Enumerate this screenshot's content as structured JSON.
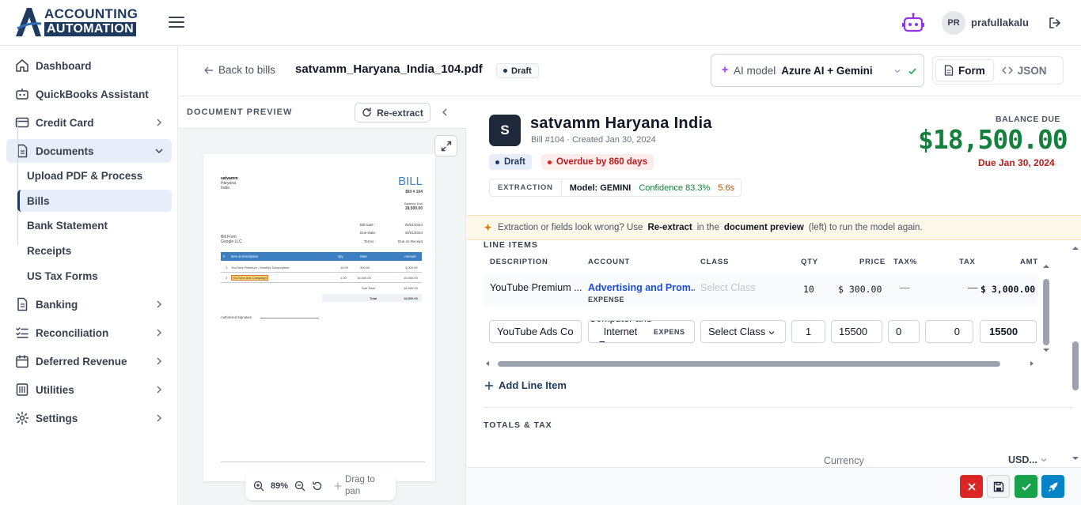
{
  "brand": {
    "line1": "ACCOUNTING",
    "line2": "AUTOMATION"
  },
  "user": {
    "initials": "PR",
    "name": "prafullakalu"
  },
  "sidebar": {
    "items": [
      {
        "label": "Dashboard"
      },
      {
        "label": "QuickBooks Assistant"
      },
      {
        "label": "Credit Card"
      },
      {
        "label": "Documents"
      },
      {
        "label": "Banking"
      },
      {
        "label": "Reconciliation"
      },
      {
        "label": "Deferred Revenue"
      },
      {
        "label": "Utilities"
      },
      {
        "label": "Settings"
      }
    ],
    "documents_sub": [
      {
        "label": "Upload PDF & Process"
      },
      {
        "label": "Bills"
      },
      {
        "label": "Bank Statement"
      },
      {
        "label": "Receipts"
      },
      {
        "label": "US Tax Forms"
      }
    ]
  },
  "header": {
    "back_label": "Back to bills",
    "filename": "satvamm_Haryana_India_104.pdf",
    "status": "Draft",
    "ai_model_label": "AI model",
    "ai_model_value": "Azure AI + Gemini",
    "view_form": "Form",
    "view_json": "JSON"
  },
  "preview": {
    "title": "DOCUMENT PREVIEW",
    "reextract": "Re-extract",
    "zoom": "89%",
    "pan_hint": "Drag to pan"
  },
  "bill_preview": {
    "company": "satvamm",
    "company_line2": "Haryana",
    "company_line3": "India",
    "doc_title": "BILL",
    "doc_num": "Bill # 104",
    "balance_due_lbl": "Balance Due",
    "balance_due": "18,500.00",
    "bill_date_lbl": "Bill Date :",
    "bill_date": "30/01/2024",
    "due_date_lbl": "Due Date :",
    "due_date": "30/01/2024",
    "terms_lbl": "Terms :",
    "terms": "Due on Receipt",
    "bill_from": "Bill From",
    "vendor": "Google LLC",
    "cols": [
      "#",
      "Item & Description",
      "Qty",
      "Rate",
      "Amount"
    ],
    "rows": [
      [
        "1",
        "YouTube Premium - Monthly Subscription",
        "10.00",
        "300.00",
        "3,000.00"
      ],
      [
        "2",
        "YouTube Ads Campaign",
        "1.00",
        "15,500.00",
        "15,500.00"
      ]
    ],
    "subtotal_lbl": "Sub Total",
    "subtotal": "18,500.00",
    "total_lbl": "Total",
    "total": "18,500.00",
    "signature": "Authorized Signature"
  },
  "bill": {
    "vendor_initial": "S",
    "vendor": "satvamm Haryana India",
    "meta": "Bill #104 · Created Jan 30, 2024",
    "status": "Draft",
    "overdue": "Overdue by 860 days",
    "extraction_label": "EXTRACTION",
    "model": "Model: GEMINI",
    "confidence": "Confidence 83.3%",
    "time": "5.6s",
    "balance_label": "BALANCE DUE",
    "balance": "$18,500.00",
    "due": "Due Jan 30, 2024"
  },
  "banner": {
    "text1": "Extraction or fields look wrong? Use",
    "bold1": "Re-extract",
    "text2": "in the",
    "bold2": "document preview",
    "text3": "(left) to run the model again."
  },
  "line_items": {
    "title": "LINE ITEMS",
    "columns": [
      "DESCRIPTION",
      "ACCOUNT",
      "CLASS",
      "QTY",
      "PRICE",
      "TAX%",
      "TAX",
      "AMT"
    ],
    "row1": {
      "description": "YouTube Premium ...",
      "account": "Advertising and Prom...",
      "account_type": "EXPENSE",
      "class_placeholder": "Select Class",
      "qty": "10",
      "price": "$ 300.00",
      "taxpct": "—",
      "tax": "—",
      "amt": "$ 3,000.00"
    },
    "row2": {
      "description": "YouTube Ads Co",
      "account": "Computer and Internet Expenses",
      "account_type": "EXPENS",
      "class": "Select Class",
      "qty": "1",
      "price": "15500",
      "taxpct": "0",
      "tax": "0",
      "amt": "15500"
    },
    "add_label": "Add Line Item"
  },
  "totals": {
    "title": "TOTALS & TAX",
    "currency_label": "Currency",
    "currency_value": "USD..."
  },
  "colors": {
    "brand": "#1e3a5f",
    "balance": "#15803d",
    "danger": "#dc2626",
    "success": "#16a34a",
    "primary": "#0284c7"
  }
}
